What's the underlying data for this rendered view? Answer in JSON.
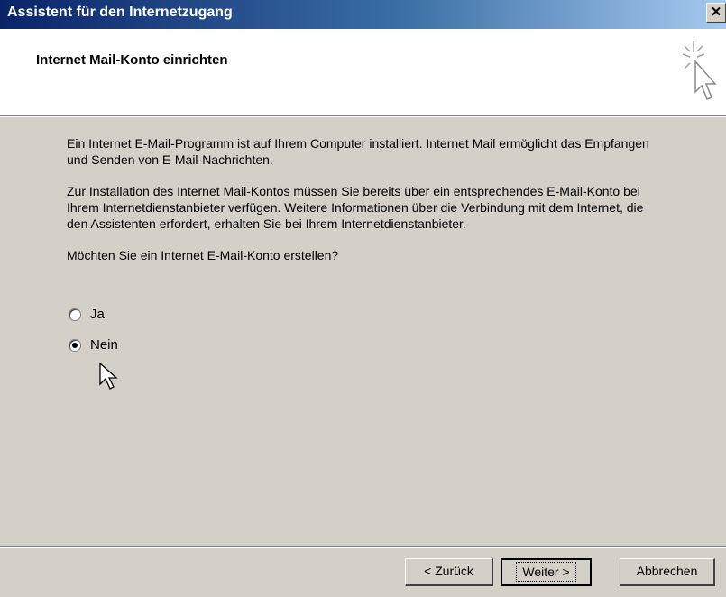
{
  "window": {
    "title": "Assistent für den Internetzugang",
    "close_glyph": "✕"
  },
  "header": {
    "title": "Internet Mail-Konto einrichten",
    "icon": "wizard-cursor-icon"
  },
  "content": {
    "paragraph1": "Ein Internet E-Mail-Programm ist auf Ihrem Computer installiert. Internet Mail ermöglicht das Empfangen und Senden von E-Mail-Nachrichten.",
    "paragraph2": "Zur Installation des Internet Mail-Kontos müssen Sie bereits über ein entsprechendes E-Mail-Konto bei Ihrem Internetdienstanbieter verfügen. Weitere Informationen über die Verbindung mit dem Internet, die den Assistenten erfordert, erhalten Sie bei Ihrem Internetdienstanbieter.",
    "question": "Möchten Sie ein Internet E-Mail-Konto erstellen?",
    "options": [
      {
        "label": "Ja",
        "selected": false
      },
      {
        "label": "Nein",
        "selected": true
      }
    ]
  },
  "buttons": {
    "back": "< Zurück",
    "next": "Weiter >",
    "cancel": "Abbrechen"
  }
}
